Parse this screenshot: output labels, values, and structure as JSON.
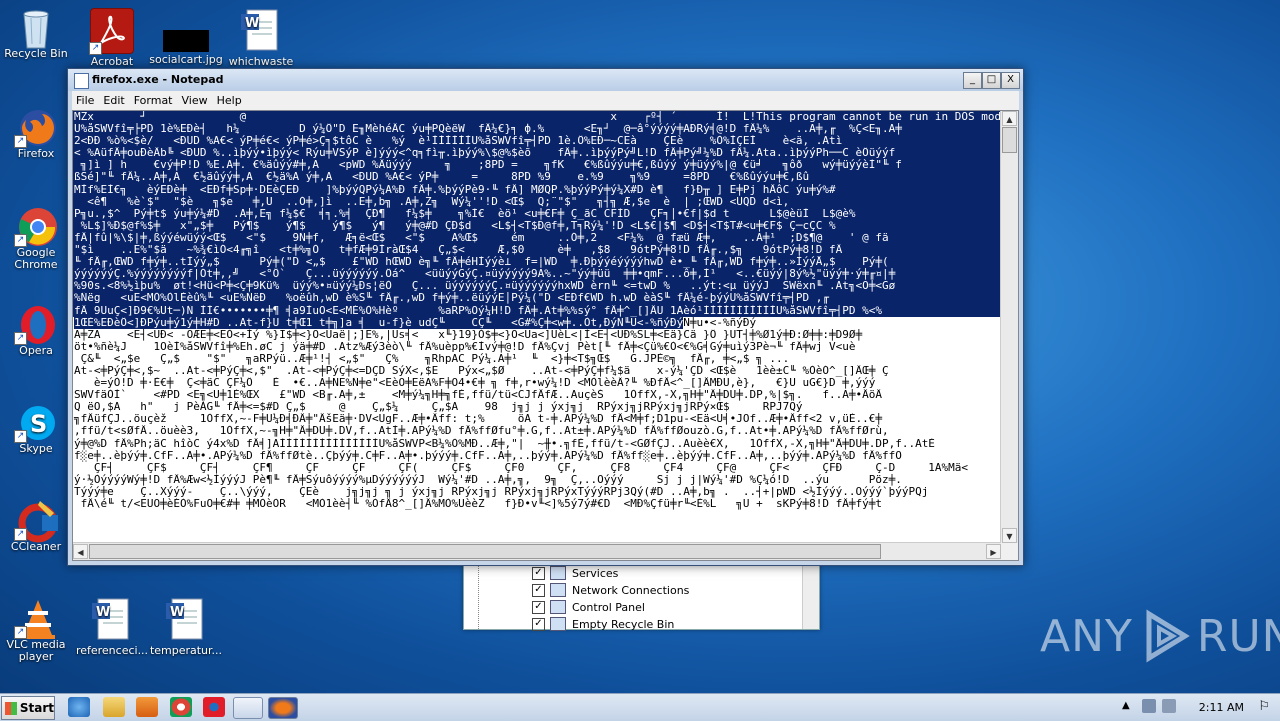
{
  "desktop": {
    "icons": [
      {
        "label": "Recycle Bin"
      },
      {
        "label": "Acrobat"
      },
      {
        "label": "socialcart.jpg"
      },
      {
        "label": "whichwaste"
      },
      {
        "label": "Firefox"
      },
      {
        "label": "Google Chrome"
      },
      {
        "label": "Opera"
      },
      {
        "label": "Skype"
      },
      {
        "label": "CCleaner"
      },
      {
        "label": "VLC media player"
      },
      {
        "label": "referenceci..."
      },
      {
        "label": "temperatur..."
      }
    ]
  },
  "background_window": {
    "items": [
      {
        "label": "Services",
        "checked": true
      },
      {
        "label": "Network Connections",
        "checked": true
      },
      {
        "label": "Control Panel",
        "checked": true
      },
      {
        "label": "Empty Recycle Bin",
        "checked": true
      }
    ]
  },
  "notepad": {
    "title": "firefox.exe - Notepad",
    "menu": [
      "File",
      "Edit",
      "Format",
      "View",
      "Help"
    ],
    "window_buttons": {
      "minimize": "_",
      "maximize": "□",
      "close": "X"
    },
    "lines": [
      {
        "text": "MZx       ┘              @                                                       x    ┌º┤ ´      Í!  L!This program cannot be run in DOS mode.",
        "selected": "full"
      },
      {
        "text": "Ü%åSWVfî╤├PD 1è%EÐè┤   h¼         D ý¼Ô\"D E╖MèhéÄC ýu╪PQèëW  fÄ¼€}╕ ф.%      <E╖┘  @─â°ýýýý╪AÐRý╡@!D fÄ¼%    ..A╪,╓  %Ç<E╖.A╪",
        "selected": "full"
      },
      {
        "text": "2<ÐÐ %ò%<$è/   <ÐUD %A€< ýP╪é€< ýP╪é>Ç╕$tôC è   %ý  è¹ÌÌÌÌÌÌÜ%åSWVfî╤┤PD 1è.Ô%EÐ─~CEà    ÇEè    %Ò%ÌÇEÌ    è<ä, .Atì",
        "selected": "full"
      },
      {
        "text": "< %AüfÄ╪ouÐèÄb╚ <ÐUD %..ìþýý•ìþýý< Rýu╪VSýP è]ýýý<^q╕fì╥.ìþýý%\\$@%$èõ    fÄ╪..ìþýýPý╝L!D fÄ╪Pý╝¼%D fÄ¼.Ata..ìþýýPh──C èÔüýýf",
        "selected": "full"
      },
      {
        "text": " ╗]ì ] h    €vý╪P!D %E.A╪. €%äûýý#╪,A   <pWD %Äüýýý     ╗    ;8PD =    ╗fK   €%ßûýýu╪€,ßûýý ý╪üýý%|@ €ü╛   ╗ôð   wý╪üýýèÌ\"╙ f",
        "selected": "full"
      },
      {
        "text": "ßSé]\"╙ fÄ¼..A╪,A  €½äûýý╪,A  €½ä%A ý╪,A   <ÐUD %A€< ýP╪     =     8PD %9    e.%9    ╗%9     =8PD   €%ßûýýu╪€,ßû",
        "selected": "full"
      },
      {
        "text": "MÌf%EÌ€╗   èýEÐè╪  <EÐf╪Sp╪·DEèÇEÐ    ]%þýýQPý¼A%Ð fÄ╪.%þýýPè9·╙ fÄ] MØQP.%þýýPý╪ý¼X#D è¶   f}Ð╥ ] E╪Pj hÄôC ýu╪ý%#",
        "selected": "full"
      },
      {
        "text": "  <ê¶   %è`$\"  \"$è   ╗$e   ╪,U  ..Ó╪,]ì  ..E╪,b╗ .A╪,Z╗  Wý¼''!D <Œ$  Q;¨\"$\"   ╗┤╗ Æ,$e  è  | ;ŒWD <ÜQD d<ì,",
        "selected": "full"
      },
      {
        "text": "P╗u.,$^  Pý╪t$ ýu╪ý¼#D  .A╪,E╗ f¼$€  ╡╕.%╡  ÇÐ¶   f¼$╪    ╗%Ì€  èö¹ <u╪€F╪ Ç_ãC CFÌD   ÇF╕│•€f|$d t      L$@èüÌ  L$@è%",
        "selected": "full"
      },
      {
        "text": " %L$]%Ð$@f%$╪   x\"„$╪   Pý¶$    ý¶$    ý¶$   ý¶   ý╪@#D ÇÐ$d   <L$┤<T$Ð@f╪,T╕Rý¼'!D <L$€|$¶ <D$┤<T$T#<u╪€F$ Ç─cÇC %",
        "selected": "full"
      },
      {
        "text": "fÄ|fû|%\\$|╪,ßýýéwüýý<Œ$   <\"$    9Ñ╪f,   Æ╕ë<Œ$   <\"$    A%Œ$     ém     ..Ó╪,2   <F¼%  @ fæü Æ╪,    ..A╪¹  ;D$¶@    ' @ fä",
        "selected": "full"
      },
      {
        "text": "\"$ì    ..E%\"$ä   ~%¾€ìÓ<4╓╗î   <t╪%╗Ò   t╪fÆ╪9ÌràŒ$4   Ç„$<     Æ,$0     è╪   ,$8   9ótPý╪8!D fÄ╓.,$╗   9ótPý╪8!D fÄ",
        "selected": "full"
      },
      {
        "text": "╙ fÄ╓,ŒWD f╪ý╪..tÌýý„$      Pý╪(\"D <„$    £\"WD hŒWD è╗╙ fÄ╪éHÌýýè⊥  f=|WD  ╪.ÐþýýéýýýýhwD è•_╙ fÄ╓,WD f╪ý╪..»ÌýýÅ„$    Pý╪(",
        "selected": "full"
      },
      {
        "text": "ýýýýýýÇ.%ýýýýýýýýf|Ót╪,,╝   <°Ô`   Ç...üýýýýýý.Ôá^   <üüýýGýÇ.¤üýýýýý9A%..~\"ýý╪üü  ╪╪•qmF...ô╪,Ì¹   <..€üýý|8ý%½\"üýý╪·ý╪╓¤|╪",
        "selected": "full"
      },
      {
        "text": "%90s.<8%½ìþu%  øt!<Hü<P╪<Ç╪9Kü%  üýý%•¤üýý¼Ðs¦ëÒ   Ç... üýýýýýýÇ.¤üýýýýýýhxWD èrn╙ <=twD %   ..ýt:<µ üýýJ  SWëxn╙ .At╗<O╪<Gø",
        "selected": "full"
      },
      {
        "text": "%Ñëg   <uE<MÒ%ÒlÈèû%╙ <uE%ÑëÐ   %oëûh,wD è%S╙ fÄ╓.,wD f╪ý╪..ëüýýE│Pý¼(\"D <EÐf€WD h.wD èàS╙ fÄ¼é-þýýÜ%åSWVfî╤┤PD ,╓",
        "selected": "full"
      },
      {
        "text": "fÄ 9UuÇ<]Ð9€%Ut─)Ñ ÌÌ€•••••••╪¶ ╡a9ÌuÖ<E<MÉ%Ò%Hèº      %aRP%Öý¼H!D fÄ╪.At╪%%sý° fÄ╪^_[]ÄÜ 1Aèó¹ÌÌÌÌÌÌÌÌÌÌÌÜ%åSWVfî╤┤PD %<%",
        "selected": "full"
      },
      {
        "text": "1ŒÈ%EÐèÔ<]ÐPýu╪ý1ý╪H#D ..At-f}U t╪Œ1 t╪╗]a ╡  u-f}è udÇ╙    CÇ╙   <G#%Ç╪<w╪..Òt,ÐýN╙U<-%ñýÐý",
        "selected": "part",
        "rest": "Ñ╪u•<-%ñýÐý"
      },
      {
        "text": "A╪ZA    <E┤<UÐ< -ÖÆE╪<EÒ<+Ìý %}I$╪<}Ö<Üaë|;]E%,|Us╡<   x╙}19}Ò$╪<}Ö<Üa<]UèL<|Ì<E┤<UÐ%SL╪<Eä}Cä }Ô }UT┤╪%Ø1ý╪Ð:Ø╪╪:╪D9Ø╪",
        "selected": "none"
      },
      {
        "text": "öt•%ñè¼J    1ÖèÌ%åSWVfî╪%Eh.øC j ýä╪#D .Atz%Æý3èò\\╙ fÄ%uèpp%€Ìvý╪@!D fÄ%Çvj Pèt[╙ fÄ╪<Çü%€Ò<€%G╡Gý╪uìý3Pè¬╙ fÄ╪wj V<uè",
        "selected": "none"
      },
      {
        "text": " Ç&╙  <„$e   Ç„$    \"$\"   ╗aRPýü..Æ╪¹!┤ <„$\"   Ç%    ╗RhpAC Pý¼.A╪¹  ╙  <}╪<T$╗Œ$   G.JPÈ©╗  fÄ╓, ╪<„$ ╗ ...",
        "selected": "none"
      },
      {
        "text": "At-<╪PýÇ╪<,$~  ..At-<╪PýÇ╪<,$\"  .At-<╪PýÇ╪<=DÇD SýX<,$E   Pýx<„$Ø    ..At-<╪PýÇ╪f¼$ä    x-ý¼'ÇD <Œ$è   1èè±C╙ %ÒèÓ^_[]ÄŒ╪ Ç",
        "selected": "none"
      },
      {
        "text": "   è=ýÒ!D ╪·È€╪  Ç<╪äC ÇF¼Ô   È  •€..A╪NE%Ñ╪e\"<EèÖ╪EëA%F╪Ö4•€╪ ╗ f╪,r•wý¼!D <MÒlèèÂ?╙ %ÐfÄ<^_[]ÄMÐU,è},   €}U uG€}D ╪,ýýý",
        "selected": "none"
      },
      {
        "text": "SWVfäÒÌ`    <#PD <E╗<U╪1È%ŒX   £\"WD <B╓.A╪,±    <M╪ý¼╗H╪╗fÈ,ffü/tü<CJfÄfÆ..AuçèŠ   1ÒffX,-X,╗H╪\"Ä╪DÜ╪.DP,%|$╗.   f..A╪•ÄöÄ",
        "selected": "none"
      },
      {
        "text": "Q ëÖ,$A   h\"   j PèÀG╙ fÄ╪<=$#D Ç„$     @    Ç„$¼     Ç„$A    98  j╗j j ýxj╗j  RPýxj╗jRPýxj╗jRPý×Œ$     RPJ7Qý",
        "selected": "none"
      },
      {
        "text": "╗fÄüfÇJ..öuçèž     1ÒffX,~-F╪U¼Ð╡ÐÄ╪\"ÄšEä╪·DV<UgF..Æ╪•Äff: t;%     öA t-╪.APý¼%D fÄ<M╪f;D1pu-<Eä<U╡•JOf..Æ╪•Äff<2 v,üÈ..€╪",
        "selected": "none"
      },
      {
        "text": ",ffü/t<sØfÄ..öuèè3,   1ÒffX,~-╗H╪\"Ä╪DÜ╪.DV,f..AtÌ╪.APý¼%D fÄ%ffØfu°╪.G,f..At±╪.APý¼%D fÄ%ffØouzò.G,f..At•╪.APý¼%D fÄ%ffØrù,",
        "selected": "none"
      },
      {
        "text": "ý╪@%D fÄ%Ph;äC hîòC ý4x%D fÄ╡]AÌÌÌÌÌÌÌÌÌÌÌÌÌÌÌÜ%åSWVP<B¼%Ò%MÐ..Æ╪,\"|  ~╫•.╗fÈ,ffü/t-<GØfÇJ..Auèè€X,   1ÒffX,-X,╗H╪\"Ä╪DÜ╪.DP,f..AtÈ",
        "selected": "none"
      },
      {
        "text": "f░e╪..èþýý╪.CfF..A╪•.APý¼%D fÄ%ffØtè..Çþýý╪.C╪F..A╪•.þýýý╪.CfF..A╪,..þýý╪.APý¼%D fÄ%ff░e╪..èþýý╪.CfF..A╪,..þýý╪.APý¼%D fÄ%ffÖ",
        "selected": "none"
      },
      {
        "text": "   ÇF┤     ÇF$     ÇF┤     ÇF¶     ÇF     ÇF     ÇF(     ÇF$     ÇF0     ÇF,     ÇF8     ÇF4     ÇF@     ÇF<     ÇFÐ     Ç-D     1A%Mä<",
        "selected": "none"
      },
      {
        "text": "ý·½ÒýýýýWý╪!D fÄ%Æw<½ÌýýýJ Pè¶╙ fÄ╪Sýuôýýýý%µDýýýýýýJ  Wý¼'#D ..A╪,╗,  9╗  Ç,..Öýýý     Sj j j|Wý¼'#D %Ç¼ó!D  ..ýu      Pöz╪.",
        "selected": "none"
      },
      {
        "text": "Týýý╪e    Ç..Xýýý-    Ç..\\ýýý,    ÇEè    j╗j╗j ╗ j ýxj╗j RPýxj╗j RPýxj╗jRPýxTýýýRPj3Qý(#D ..A╪,b╗ .  ..┤+|pWD <½Ìýýý..Öýýý`þýýPQj",
        "selected": "none"
      },
      {
        "text": " fÄ\\é╙ t/<EUÖ╪èÉÒ%FuÖ╪€#╪ ╪MÒèÒR   <MÒ1èè┤╙ %ÒfÄ8^_[]Ä%MÒ%ÜèèZ   f}Ð•v╙<]%5ý7ý#€D  <MÐ%Çfü╪r╙<È%L   ╗U +  sKPý╪8!D fÄ╪fý╪t",
        "selected": "none"
      }
    ]
  },
  "taskbar": {
    "start_label": "Start",
    "clock": "2:11 AM"
  },
  "watermark": {
    "text_left": "ANY",
    "text_right": "RUN"
  }
}
